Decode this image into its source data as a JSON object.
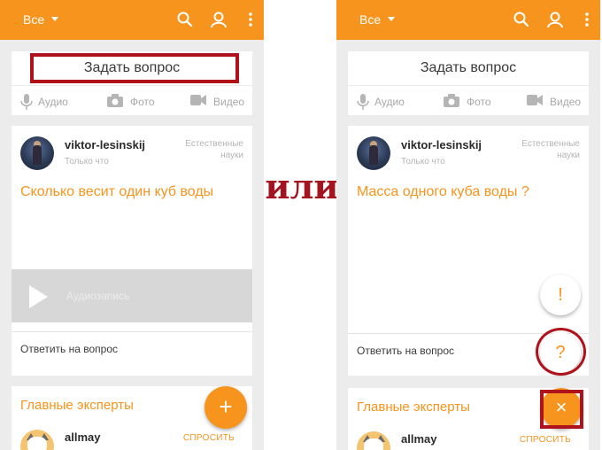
{
  "colors": {
    "accent": "#f7941d",
    "annotation_red": "#b0121b",
    "background": "#ececec"
  },
  "separator_text": "или",
  "screens": {
    "left": {
      "topbar": {
        "category": "Все",
        "icons": [
          "dropdown-caret-icon",
          "search-icon",
          "profile-icon",
          "more-vert-icon"
        ]
      },
      "ask": {
        "title": "Задать вопрос",
        "audio": "Аудио",
        "photo": "Фото",
        "video": "Видео"
      },
      "question": {
        "user": "viktor-lesinskij",
        "time": "Только что",
        "subject": "Естественные науки",
        "text": "Сколько весит один куб воды",
        "audio_label": "Аудиозапись",
        "answer": "Ответить на вопрос"
      },
      "experts": {
        "title": "Главные эксперты",
        "name": "allmay",
        "ask": "СПРОСИТЬ"
      },
      "fab": "+"
    },
    "right": {
      "topbar": {
        "category": "Все",
        "icons": [
          "dropdown-caret-icon",
          "search-icon",
          "profile-icon",
          "more-vert-icon"
        ]
      },
      "ask": {
        "title": "Задать вопрос",
        "audio": "Аудио",
        "photo": "Фото",
        "video": "Видео"
      },
      "question": {
        "user": "viktor-lesinskij",
        "time": "Только что",
        "subject": "Естественные науки",
        "text": "Масса одного куба воды ?",
        "answer": "Ответить на вопрос"
      },
      "experts": {
        "title": "Главные эксперты",
        "name": "allmay",
        "ask": "СПРОСИТЬ"
      },
      "fab_exclaim": "!",
      "fab_question": "?",
      "fab_close": "×"
    }
  }
}
